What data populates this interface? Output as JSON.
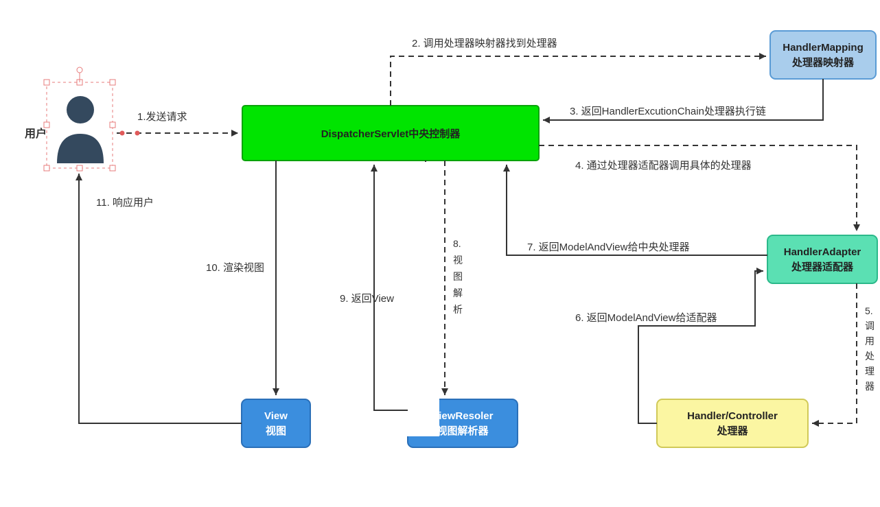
{
  "nodes": {
    "user": {
      "label": "用户"
    },
    "dispatcher": {
      "title": "DispatcherServlet中央控制器"
    },
    "handlerMapping": {
      "line1": "HandlerMapping",
      "line2": "处理器映射器"
    },
    "handlerAdapter": {
      "line1": "HandlerAdapter",
      "line2": "处理器适配器"
    },
    "handler": {
      "line1": "Handler/Controller",
      "line2": "处理器"
    },
    "viewResolver": {
      "line1": "ViewResoler",
      "line2": "视图解析器"
    },
    "view": {
      "line1": "View",
      "line2": "视图"
    }
  },
  "edges": {
    "e1": "1.发送请求",
    "e2": "2.  调用处理器映射器找到处理器",
    "e3": "3.  返回HandlerExcutionChain处理器执行链",
    "e4": "4.  通过处理器适配器调用具体的处理器",
    "e5a": "5.",
    "e5b": "调",
    "e5c": "用",
    "e5d": "处",
    "e5e": "理",
    "e5f": "器",
    "e6": "6.  返回ModelAndView给适配器",
    "e7": "7.  返回ModelAndView给中央处理器",
    "e8a": "8.",
    "e8b": "视",
    "e8c": "图",
    "e8d": "解",
    "e8e": "析",
    "e9": "9.  返回View",
    "e10": "10.  渲染视图",
    "e11": "11.  响应用户"
  }
}
